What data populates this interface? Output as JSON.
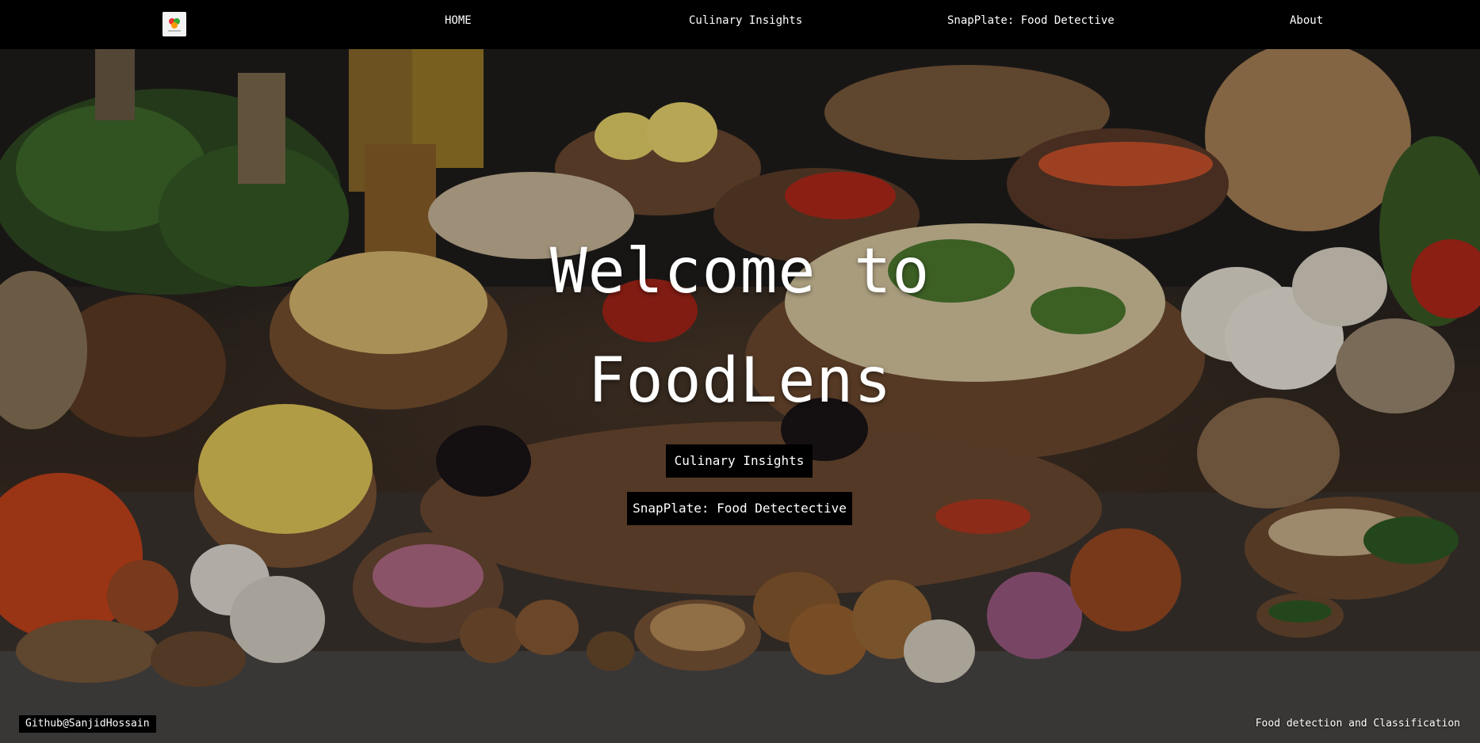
{
  "nav": {
    "logo_alt": "FoodLens",
    "items": [
      {
        "label": "HOME"
      },
      {
        "label": "Culinary Insights"
      },
      {
        "label": "SnapPlate: Food Detective"
      },
      {
        "label": "About"
      }
    ]
  },
  "hero": {
    "title_line1": "Welcome to",
    "title_line2": "FoodLens",
    "buttons": [
      {
        "label": "Culinary Insights"
      },
      {
        "label": "SnapPlate: Food Detectective"
      }
    ],
    "background_image": "assorted food ingredients in wooden bowls"
  },
  "footer": {
    "left": "Github@SanjidHossain",
    "right": "Food detection and Classification"
  },
  "colors": {
    "navbar": "#000000",
    "button_bg": "#000000",
    "text": "#ffffff"
  }
}
